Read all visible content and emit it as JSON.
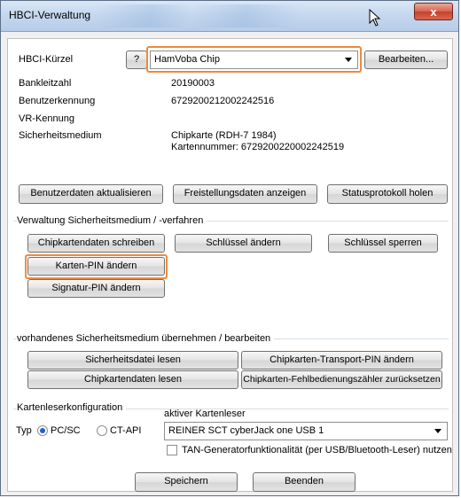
{
  "window": {
    "title": "HBCI-Verwaltung",
    "close_glyph": "x"
  },
  "top": {
    "kuerzel_label": "HBCI-Kürzel",
    "help_button": "?",
    "kuerzel_value": "HamVoba Chip",
    "edit_button": "Bearbeiten..."
  },
  "info": {
    "blz_label": "Bankleitzahl",
    "blz_value": "20190003",
    "user_label": "Benutzerkennung",
    "user_value": "6729200212002242516",
    "vr_label": "VR-Kennung",
    "medium_label": "Sicherheitsmedium",
    "medium_line1": "Chipkarte  (RDH-7  1984)",
    "medium_line2": "Kartennummer: 6729200220002242519"
  },
  "actions": {
    "update_user": "Benutzerdaten aktualisieren",
    "show_release": "Freistellungsdaten anzeigen",
    "status_log": "Statusprotokoll holen"
  },
  "admin": {
    "title": "Verwaltung Sicherheitsmedium / -verfahren",
    "write_chip": "Chipkartendaten schreiben",
    "change_key": "Schlüssel ändern",
    "lock_key": "Schlüssel sperren",
    "card_pin": "Karten-PIN ändern",
    "sign_pin": "Signatur-PIN ändern"
  },
  "existing": {
    "title": "vorhandenes Sicherheitsmedium übernehmen / bearbeiten",
    "read_file": "Sicherheitsdatei lesen",
    "transport_pin": "Chipkarten-Transport-PIN ändern",
    "read_chip": "Chipkartendaten lesen",
    "reset_error": "Chipkarten-Fehlbedienungszähler zurücksetzen"
  },
  "reader": {
    "title": "Kartenleserkonfiguration",
    "type_label": "Typ",
    "opt_pcsc": "PC/SC",
    "opt_ctapi": "CT-API",
    "selected": "PC/SC",
    "active_label": "aktiver Kartenleser",
    "active_value": "REINER SCT cyberJack one USB 1",
    "tan_option": "TAN-Generatorfunktionalität (per USB/Bluetooth-Leser) nutzen",
    "tan_checked": false
  },
  "footer": {
    "save": "Speichern",
    "quit": "Beenden"
  },
  "colors": {
    "highlight": "#ef8a3d",
    "radio_dot": "#2060c8",
    "close_red": "#c5412c"
  }
}
